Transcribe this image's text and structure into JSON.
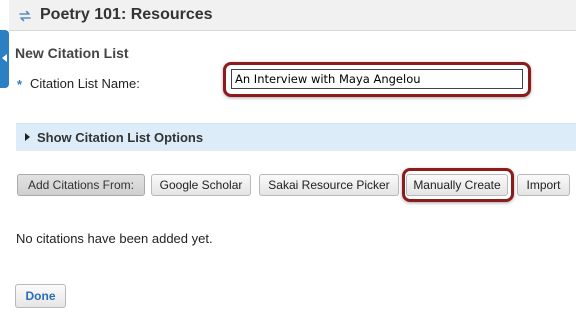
{
  "header": {
    "title": "Poetry 101: Resources",
    "icon": "swap-arrows-icon"
  },
  "form": {
    "section_title": "New Citation List",
    "required_marker": "*",
    "name_label": "Citation List Name:",
    "name_value": "An Interview with Maya Angelou"
  },
  "options": {
    "toggle_label": "Show Citation List Options"
  },
  "toolbar": {
    "from_label": "Add Citations From:",
    "google_label": "Google Scholar",
    "sakai_label": "Sakai Resource Picker",
    "manual_label": "Manually Create",
    "import_label": "Import"
  },
  "status": {
    "empty_message": "No citations have been added yet."
  },
  "footer": {
    "done_label": "Done"
  },
  "colors": {
    "accent": "#2b7fc3",
    "highlight": "#8c1b1b",
    "options_bar": "#dcedf9"
  }
}
